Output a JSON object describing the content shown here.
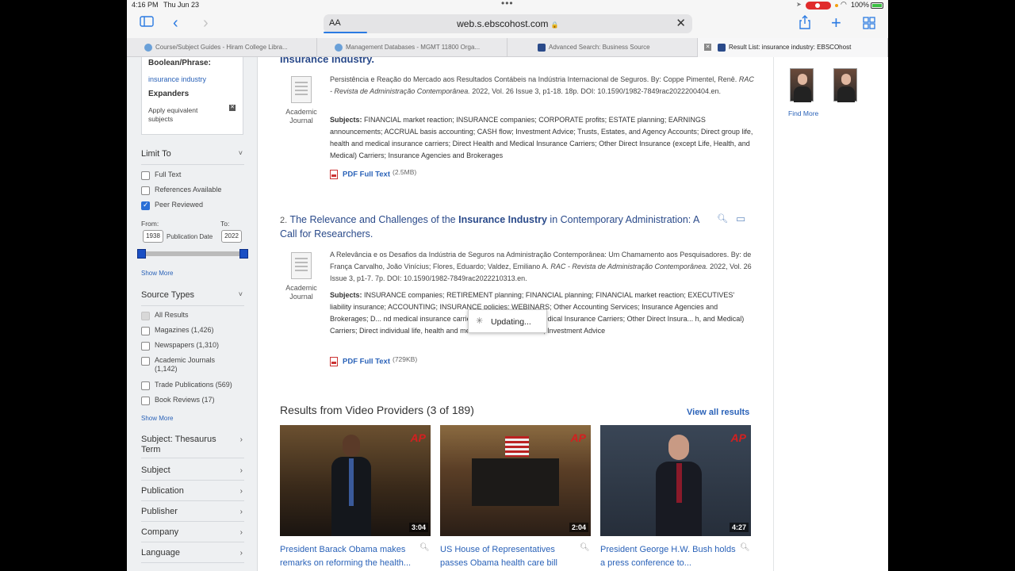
{
  "status": {
    "time": "4:16 PM",
    "date": "Thu Jun 23",
    "battery": "100%"
  },
  "toolbar": {
    "aa": "AA",
    "url": "web.s.ebscohost.com",
    "lock": "🔒"
  },
  "tabs": [
    {
      "label": "Course/Subject Guides - Hiram College Libra..."
    },
    {
      "label": "Management Databases - MGMT 11800 Orga..."
    },
    {
      "label": "Advanced Search: Business Source"
    },
    {
      "label": "Result List: insurance industry: EBSCOhost"
    }
  ],
  "sidebar": {
    "boolean_label": "Boolean/Phrase:",
    "boolean_value": "insurance industry",
    "expanders_label": "Expanders",
    "expander_item": "Apply equivalent subjects",
    "limit_to": "Limit To",
    "limits": [
      {
        "label": "Full Text",
        "checked": false
      },
      {
        "label": "References Available",
        "checked": false
      },
      {
        "label": "Peer Reviewed",
        "checked": true
      }
    ],
    "from_label": "From:",
    "to_label": "To:",
    "from_year": "1938",
    "to_year": "2022",
    "pub_date_label": "Publication Date",
    "show_more": "Show More",
    "source_types": "Source Types",
    "sources": [
      {
        "label": "All Results"
      },
      {
        "label": "Magazines (1,426)"
      },
      {
        "label": "Newspapers (1,310)"
      },
      {
        "label": "Academic Journals (1,142)"
      },
      {
        "label": "Trade Publications (569)"
      },
      {
        "label": "Book Reviews (17)"
      }
    ],
    "show_more_2": "Show More",
    "facets": [
      "Subject: Thesaurus Term",
      "Subject",
      "Publication",
      "Publisher",
      "Company",
      "Language"
    ]
  },
  "result1": {
    "title_tail": "Insurance Industry.",
    "doc_type": "Academic Journal",
    "abstract_plain": "Persistência e Reação do Mercado aos Resultados Contábeis na Indústria Internacional de Seguros. By: Coppe Pimentel, Renê.",
    "abstract_journal": "RAC - Revista de Administração Contemporânea.",
    "abstract_rest": "2022, Vol. 26 Issue 3, p1-18. 18p. DOI: 10.1590/1982-7849rac2022200404.en.",
    "subjects_label": "Subjects:",
    "subjects": "FINANCIAL market reaction; INSURANCE companies; CORPORATE profits; ESTATE planning; EARNINGS announcements; ACCRUAL basis accounting; CASH flow; Investment Advice; Trusts, Estates, and Agency Accounts; Direct group life, health and medical insurance carriers; Direct Health and Medical Insurance Carriers; Other Direct Insurance (except Life, Health, and Medical) Carriers; Insurance Agencies and Brokerages",
    "pdf_label": "PDF Full Text",
    "pdf_size": "(2.5MB)"
  },
  "result2": {
    "number": "2.",
    "title_pre": "The Relevance and Challenges of the",
    "title_bold": "Insurance Industry",
    "title_post": "in Contemporary Administration: A Call for Researchers.",
    "doc_type": "Academic Journal",
    "abstract_plain": "A Relevância e os Desafios da Indústria de Seguros na Administração Contemporânea: Um Chamamento aos Pesquisadores. By: de França Carvalho, João Vinícius; Flores, Eduardo; Valdez, Emiliano A.",
    "abstract_journal": "RAC - Revista de Administração Contemporânea.",
    "abstract_rest": "2022, Vol. 26 Issue 3, p1-7. 7p. DOI: 10.1590/1982-7849rac2022210313.en.",
    "subjects_label": "Subjects:",
    "subjects": "INSURANCE companies; RETIREMENT planning; FINANCIAL planning; FINANCIAL market reaction; EXECUTIVES' liability insurance; ACCOUNTING; INSURANCE policies; WEBINARS; Other Accounting Services; Insurance Agencies and Brokerages; D... nd medical insurance carriers; Direct Health and Medical Insurance Carriers; Other Direct Insura... h, and Medical) Carriers; Direct individual life, health and medical insurance carriers; Investment Advice",
    "pdf_label": "PDF Full Text",
    "pdf_size": "(729KB)"
  },
  "updating": "Updating...",
  "videos": {
    "heading": "Results from Video Providers (3 of 189)",
    "view_all": "View all results",
    "ap": "AP",
    "items": [
      {
        "duration": "3:04",
        "caption": "President Barack Obama makes remarks on reforming the health..."
      },
      {
        "duration": "2:04",
        "caption": "US House of Representatives passes Obama health care bill"
      },
      {
        "duration": "4:27",
        "caption": "President George H.W. Bush holds a press conference to..."
      }
    ]
  },
  "right": {
    "find_more": "Find More"
  }
}
